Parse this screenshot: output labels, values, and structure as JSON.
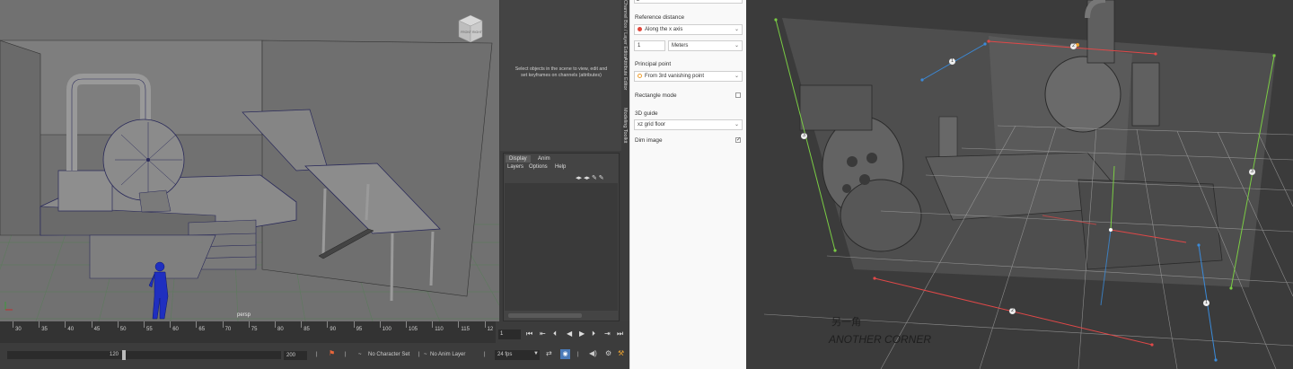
{
  "viewport": {
    "camera_label": "persp",
    "viewcube": {
      "front": "FRONT",
      "right": "RIGHT"
    }
  },
  "attribute_panel": {
    "message": "Select objects in the scene to view, edit and set keyframes on channels (attributes)"
  },
  "side_tabs": [
    "Channel Box / Layer Editor",
    "Attribute Editor",
    "Modeling Toolkit"
  ],
  "layer_editor": {
    "tabs": [
      "Display",
      "Anim"
    ],
    "active_tab": "Display",
    "menus": [
      "Layers",
      "Options",
      "Help"
    ]
  },
  "timeline": {
    "ticks": [
      "30",
      "35",
      "40",
      "45",
      "50",
      "55",
      "60",
      "65",
      "70",
      "75",
      "80",
      "85",
      "90",
      "95",
      "100",
      "105",
      "110",
      "115",
      "12"
    ],
    "current_frame": "1"
  },
  "range_bar": {
    "current_end": "120",
    "max_end": "200",
    "character_set": "No Character Set",
    "anim_layer": "No Anim Layer",
    "fps": "24 fps"
  },
  "settings_panel": {
    "top_partial": "2",
    "reference_distance": {
      "label": "Reference distance",
      "axis_option": "Along the x axis",
      "axis_color": "#e0463b",
      "value": "1",
      "unit": "Meters"
    },
    "principal_point": {
      "label": "Principal point",
      "option": "From 3rd vanishing point",
      "option_color": "#f0a030"
    },
    "rectangle_mode": {
      "label": "Rectangle mode",
      "checked": false
    },
    "guide": {
      "label": "3D guide",
      "option": "xz grid floor"
    },
    "dim_image": {
      "label": "Dim image",
      "checked": true
    }
  },
  "photo": {
    "handwriting": "ANOTHER CORNER",
    "markers": [
      "1",
      "2",
      "3",
      "2",
      "3",
      "1"
    ]
  }
}
